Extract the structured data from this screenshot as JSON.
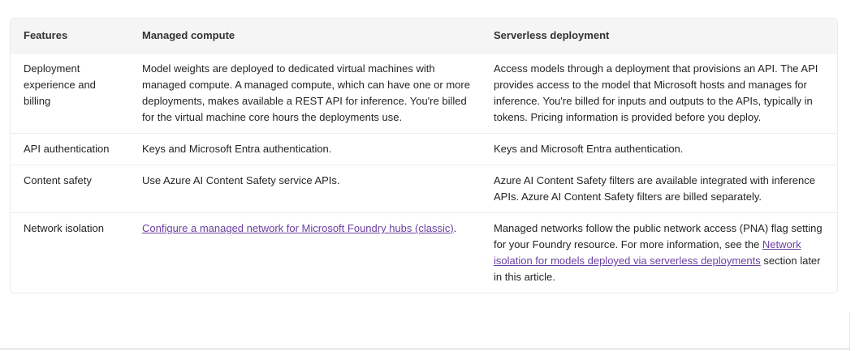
{
  "table": {
    "headers": {
      "features": "Features",
      "managed": "Managed compute",
      "serverless": "Serverless deployment"
    },
    "rows": [
      {
        "feature": "Deployment experience and billing",
        "managed": "Model weights are deployed to dedicated virtual machines with managed compute. A managed compute, which can have one or more deployments, makes available a REST API for inference. You're billed for the virtual machine core hours the deployments use.",
        "serverless": "Access models through a deployment that provisions an API. The API provides access to the model that Microsoft hosts and manages for inference. You're billed for inputs and outputs to the APIs, typically in tokens. Pricing information is provided before you deploy."
      },
      {
        "feature": "API authentication",
        "managed": "Keys and Microsoft Entra authentication.",
        "serverless": "Keys and Microsoft Entra authentication."
      },
      {
        "feature": "Content safety",
        "managed": "Use Azure AI Content Safety service APIs.",
        "serverless": "Azure AI Content Safety filters are available integrated with inference APIs. Azure AI Content Safety filters are billed separately."
      },
      {
        "feature": "Network isolation",
        "managed_link": "Configure a managed network for Microsoft Foundry hubs (classic)",
        "managed_suffix": ".",
        "serverless_prefix": "Managed networks follow the public network access (PNA) flag setting for your Foundry resource. For more information, see the ",
        "serverless_link": "Network isolation for models deployed via serverless deployments",
        "serverless_suffix": " section later in this article."
      }
    ]
  },
  "colors": {
    "link": "#6b3fa0",
    "header_bg": "#f5f5f5",
    "border": "#ececec"
  }
}
